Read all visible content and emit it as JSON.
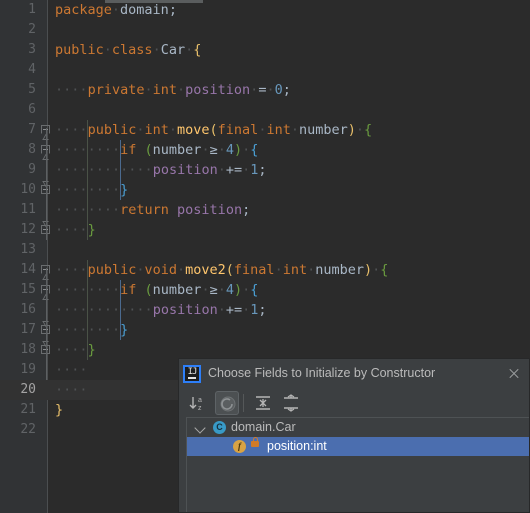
{
  "editor": {
    "language": "java",
    "lines": [
      {
        "num": "1",
        "indent_dots": 0,
        "tokens": [
          {
            "t": "package",
            "c": "kw"
          },
          {
            "t": " ",
            "c": "dot-sp"
          },
          {
            "t": "domain",
            "c": "cls"
          },
          {
            "t": ";",
            "c": "pl"
          }
        ]
      },
      {
        "num": "2",
        "indent_dots": 0,
        "tokens": []
      },
      {
        "num": "3",
        "indent_dots": 0,
        "tokens": [
          {
            "t": "public",
            "c": "kw"
          },
          {
            "t": " ",
            "c": "dot-sp"
          },
          {
            "t": "class",
            "c": "kw"
          },
          {
            "t": " ",
            "c": "dot-sp"
          },
          {
            "t": "Car",
            "c": "cls"
          },
          {
            "t": " ",
            "c": "dot-sp"
          },
          {
            "t": "{",
            "c": "br0"
          }
        ]
      },
      {
        "num": "4",
        "indent_dots": 0,
        "tokens": []
      },
      {
        "num": "5",
        "indent_dots": 4,
        "tokens": [
          {
            "t": "private",
            "c": "kw"
          },
          {
            "t": " ",
            "c": "dot-sp"
          },
          {
            "t": "int",
            "c": "kw"
          },
          {
            "t": " ",
            "c": "dot-sp"
          },
          {
            "t": "position",
            "c": "fld"
          },
          {
            "t": " ",
            "c": "dot-sp"
          },
          {
            "t": "=",
            "c": "op"
          },
          {
            "t": " ",
            "c": "dot-sp"
          },
          {
            "t": "0",
            "c": "num"
          },
          {
            "t": ";",
            "c": "pl"
          }
        ]
      },
      {
        "num": "6",
        "indent_dots": 0,
        "tokens": []
      },
      {
        "num": "7",
        "indent_dots": 4,
        "tokens": [
          {
            "t": "public",
            "c": "kw"
          },
          {
            "t": " ",
            "c": "dot-sp"
          },
          {
            "t": "int",
            "c": "kw"
          },
          {
            "t": " ",
            "c": "dot-sp"
          },
          {
            "t": "move",
            "c": "mth"
          },
          {
            "t": "(",
            "c": "br0"
          },
          {
            "t": "final",
            "c": "kw"
          },
          {
            "t": " ",
            "c": "dot-sp"
          },
          {
            "t": "int",
            "c": "kw"
          },
          {
            "t": " ",
            "c": "dot-sp"
          },
          {
            "t": "number",
            "c": "pl"
          },
          {
            "t": ")",
            "c": "br0"
          },
          {
            "t": " ",
            "c": "dot-sp"
          },
          {
            "t": "{",
            "c": "br1"
          }
        ]
      },
      {
        "num": "8",
        "indent_dots": 8,
        "tokens": [
          {
            "t": "if",
            "c": "kw"
          },
          {
            "t": " ",
            "c": "sp"
          },
          {
            "t": "(",
            "c": "br1"
          },
          {
            "t": "number",
            "c": "pl"
          },
          {
            "t": " ",
            "c": "dot-sp"
          },
          {
            "t": "≥",
            "c": "op"
          },
          {
            "t": " ",
            "c": "dot-sp"
          },
          {
            "t": "4",
            "c": "num"
          },
          {
            "t": ")",
            "c": "br1"
          },
          {
            "t": " ",
            "c": "dot-sp"
          },
          {
            "t": "{",
            "c": "br2"
          }
        ]
      },
      {
        "num": "9",
        "indent_dots": 12,
        "tokens": [
          {
            "t": "position",
            "c": "fld"
          },
          {
            "t": " ",
            "c": "dot-sp"
          },
          {
            "t": "+=",
            "c": "op"
          },
          {
            "t": " ",
            "c": "dot-sp"
          },
          {
            "t": "1",
            "c": "num"
          },
          {
            "t": ";",
            "c": "pl"
          }
        ]
      },
      {
        "num": "10",
        "indent_dots": 8,
        "tokens": [
          {
            "t": "}",
            "c": "br2"
          }
        ]
      },
      {
        "num": "11",
        "indent_dots": 8,
        "tokens": [
          {
            "t": "return",
            "c": "kw"
          },
          {
            "t": " ",
            "c": "sp"
          },
          {
            "t": "position",
            "c": "fld"
          },
          {
            "t": ";",
            "c": "pl"
          }
        ]
      },
      {
        "num": "12",
        "indent_dots": 4,
        "tokens": [
          {
            "t": "}",
            "c": "br1"
          }
        ]
      },
      {
        "num": "13",
        "indent_dots": 0,
        "tokens": []
      },
      {
        "num": "14",
        "indent_dots": 4,
        "tokens": [
          {
            "t": "public",
            "c": "kw"
          },
          {
            "t": " ",
            "c": "dot-sp"
          },
          {
            "t": "void",
            "c": "kw"
          },
          {
            "t": " ",
            "c": "dot-sp"
          },
          {
            "t": "move2",
            "c": "mth"
          },
          {
            "t": "(",
            "c": "br0"
          },
          {
            "t": "final",
            "c": "kw"
          },
          {
            "t": " ",
            "c": "dot-sp"
          },
          {
            "t": "int",
            "c": "kw"
          },
          {
            "t": " ",
            "c": "dot-sp"
          },
          {
            "t": "number",
            "c": "pl"
          },
          {
            "t": ")",
            "c": "br0"
          },
          {
            "t": " ",
            "c": "dot-sp"
          },
          {
            "t": "{",
            "c": "br1"
          }
        ]
      },
      {
        "num": "15",
        "indent_dots": 8,
        "tokens": [
          {
            "t": "if",
            "c": "kw"
          },
          {
            "t": " ",
            "c": "sp"
          },
          {
            "t": "(",
            "c": "br1"
          },
          {
            "t": "number",
            "c": "pl"
          },
          {
            "t": " ",
            "c": "dot-sp"
          },
          {
            "t": "≥",
            "c": "op"
          },
          {
            "t": " ",
            "c": "dot-sp"
          },
          {
            "t": "4",
            "c": "num"
          },
          {
            "t": ")",
            "c": "br1"
          },
          {
            "t": " ",
            "c": "dot-sp"
          },
          {
            "t": "{",
            "c": "br2"
          }
        ]
      },
      {
        "num": "16",
        "indent_dots": 12,
        "tokens": [
          {
            "t": "position",
            "c": "fld"
          },
          {
            "t": " ",
            "c": "dot-sp"
          },
          {
            "t": "+=",
            "c": "op"
          },
          {
            "t": " ",
            "c": "dot-sp"
          },
          {
            "t": "1",
            "c": "num"
          },
          {
            "t": ";",
            "c": "pl"
          }
        ]
      },
      {
        "num": "17",
        "indent_dots": 8,
        "tokens": [
          {
            "t": "}",
            "c": "br2"
          }
        ]
      },
      {
        "num": "18",
        "indent_dots": 4,
        "tokens": [
          {
            "t": "}",
            "c": "br1"
          }
        ]
      },
      {
        "num": "19",
        "indent_dots": 4,
        "tokens": []
      },
      {
        "num": "20",
        "indent_dots": 4,
        "tokens": [],
        "caret": true
      },
      {
        "num": "21",
        "indent_dots": 0,
        "tokens": [
          {
            "t": "}",
            "c": "br0"
          }
        ]
      },
      {
        "num": "22",
        "indent_dots": 0,
        "tokens": []
      }
    ],
    "colors": {
      "background": "#2b2b2b",
      "gutter": "#313335",
      "keyword": "#cc7832",
      "field": "#9876aa",
      "number": "#6897bb",
      "method": "#ffc66d",
      "plain": "#a9b7c6",
      "line_number": "#606366",
      "caret_row": "#323232"
    }
  },
  "dialog": {
    "title": "Choose Fields to Initialize by Constructor",
    "logo_text": "IJ",
    "close_label": "Close",
    "toolbar": [
      {
        "name": "sort-alphabetically-button",
        "label": "Sort Alphabetically",
        "pressed": false
      },
      {
        "name": "show-non-public-button",
        "label": "Show Non-Public",
        "pressed": true
      },
      {
        "name": "expand-all-button",
        "label": "Expand All",
        "pressed": false
      },
      {
        "name": "collapse-all-button",
        "label": "Collapse All",
        "pressed": false
      }
    ],
    "tree": [
      {
        "label": "domain.Car",
        "icon": "class-icon",
        "icon_char": "C",
        "level": 0,
        "expanded": true,
        "selected": false
      },
      {
        "label": "position:int",
        "icon": "field-icon",
        "icon_char": "f",
        "level": 1,
        "locked": true,
        "selected": true
      }
    ],
    "colors": {
      "dialog_bg": "#3c3f41",
      "selection": "#4b6eaf",
      "class_icon": "#389ac7",
      "field_icon": "#d9a343",
      "lock_icon": "#d07b2a",
      "logo_border": "#2d7ff9"
    }
  }
}
